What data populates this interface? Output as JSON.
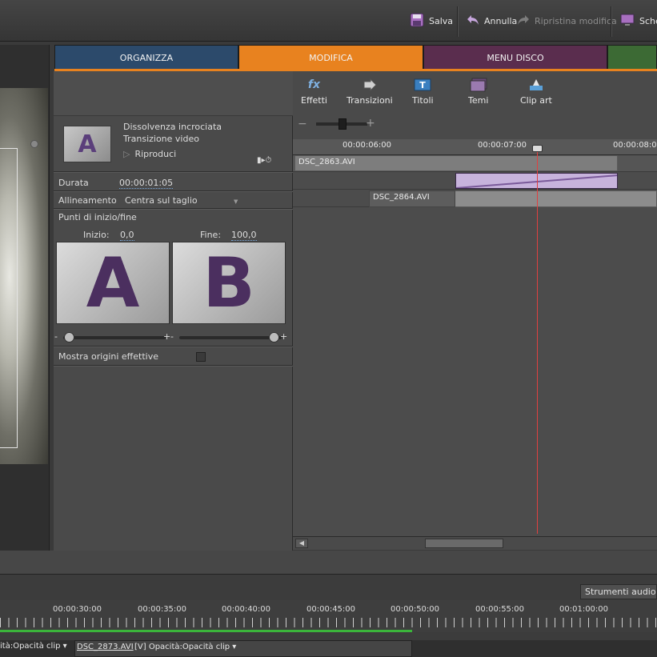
{
  "toolbar": {
    "save_label": "Salva",
    "undo_label": "Annulla",
    "redo_label": "Ripristina modifica",
    "screen_label": "Sche"
  },
  "tabs": {
    "organize": "ORGANIZZA",
    "edit": "MODIFICA",
    "disc": "MENU DISCO"
  },
  "properties": {
    "title": "Dissolvenza incrociata",
    "subtitle": "Transizione video",
    "play_label": "Riproduci",
    "duration_label": "Durata",
    "duration_value": "00:00:01:05",
    "alignment_label": "Allineamento",
    "alignment_value": "Centra sul taglio",
    "start_end_label": "Punti di inizio/fine",
    "start_label": "Inizio:",
    "start_value": "0,0",
    "end_label": "Fine:",
    "end_value": "100,0",
    "thumb_letter": "A",
    "preview_a": "A",
    "preview_b": "B",
    "show_sources_label": "Mostra origini effettive",
    "slider_minus": "-",
    "slider_plus": "+"
  },
  "effects_bar": {
    "effects": "Effetti",
    "transitions": "Transizioni",
    "titles": "Titoli",
    "themes": "Temi",
    "clipart": "Clip art"
  },
  "zoom": {
    "minus": "−",
    "plus": "+"
  },
  "ruler": {
    "t1": "00:00:06:00",
    "t2": "00:00:07:00",
    "t3": "00:00:08:00"
  },
  "clips": {
    "clip_a": "DSC_2863.AVI",
    "clip_b": "DSC_2864.AVI"
  },
  "lower": {
    "audio_tools": "Strumenti audio",
    "times": [
      "00:00:30:00",
      "00:00:35:00",
      "00:00:40:00",
      "00:00:45:00",
      "00:00:50:00",
      "00:00:55:00",
      "00:01:00:00"
    ],
    "track_label_1": "ità:Opacità clip ▾",
    "track_clip_name": "DSC_2873.AVI",
    "track_label_2": "[V]  Opacità:Opacità clip ▾"
  },
  "colors": {
    "organize_tab": "#2c4a6b",
    "edit_tab": "#e8821f",
    "disc_tab": "#5a2d4e",
    "share_tab": "#3c6a34",
    "playhead": "#e04040",
    "transition_clip": "#c7b3dc"
  }
}
